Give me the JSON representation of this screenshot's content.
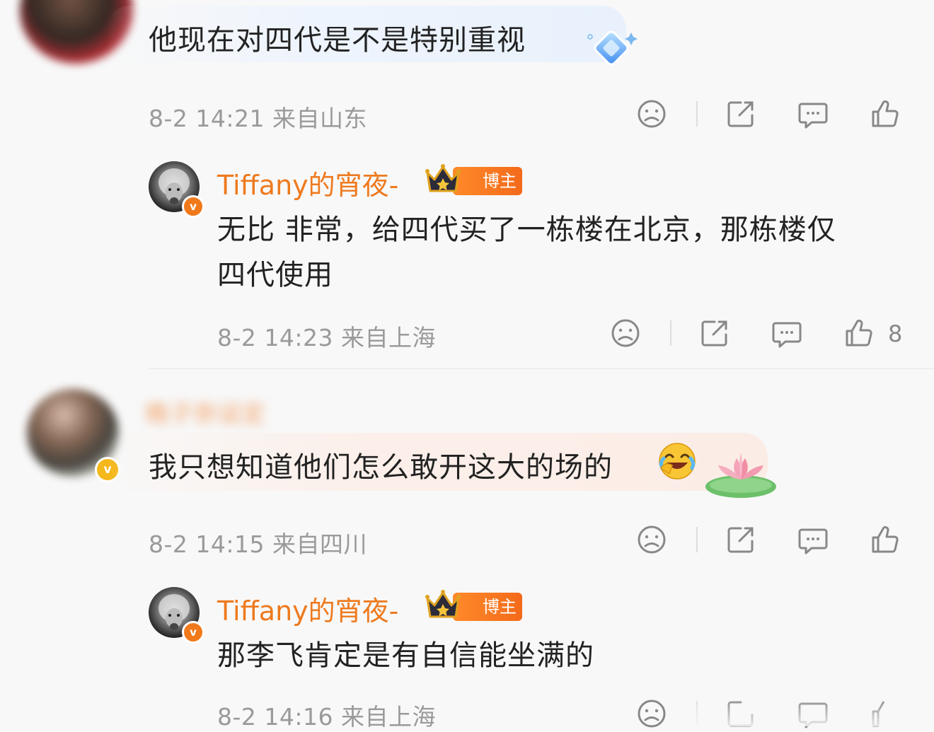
{
  "comments": [
    {
      "text": "他现在对四代是不是特别重视",
      "meta": "8-2 14:21 来自山东",
      "reply": {
        "nickname": "Tiffany的宵夜-",
        "badge": "博主",
        "text_line1": "无比 非常，给四代买了一栋楼在北京，那栋楼仅",
        "text_line2": "四代使用",
        "meta": "8-2 14:23 来自上海",
        "likes": "8"
      }
    },
    {
      "nickname_blurred": "晚子奈设定",
      "text": "我只想知道他们怎么敢开这大的场的",
      "meta": "8-2 14:15 来自四川",
      "reply": {
        "nickname": "Tiffany的宵夜-",
        "badge": "博主",
        "text_line1": "那李飞肯定是有自信能坐满的",
        "meta": "8-2 14:16 来自上海"
      }
    }
  ],
  "icons": [
    "dislike-icon",
    "share-icon",
    "comment-icon",
    "like-icon",
    "crown-icon",
    "verified-icon",
    "laughing-emoji-icon",
    "lotus-sticker-icon",
    "diamond-sticker-icon"
  ],
  "colors": {
    "accent": "#ee7a1e",
    "meta": "#9a9a9a",
    "bubble_blue": "#eef4fd",
    "bubble_peach": "#fcefe9"
  }
}
